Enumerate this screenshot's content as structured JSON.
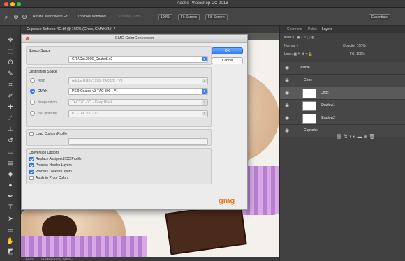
{
  "app": {
    "title": "Adobe Photoshop CC 2016"
  },
  "options": {
    "resize_windows": "Resize Windows to Fit",
    "zoom_all": "Zoom All Windows",
    "scrubby": "Scrubby Zoom",
    "zoom_pct": "100%",
    "fit_screen": "Fit Screen",
    "fill_screen": "Fill Screen",
    "workspace": "Essentials"
  },
  "document": {
    "tab": "Cupcake Schoko 4C.tif @ 100% (Choc, CMYK/8#) *",
    "status": "100%",
    "doc_info": "Unsaved GMG Ghost..."
  },
  "layers_panel": {
    "tabs": [
      "Channels",
      "Paths",
      "Layers"
    ],
    "kind": "Kind",
    "blend": "Normal",
    "opacity": "Opacity: 100%",
    "lock": "Lock:",
    "fill": "Fill: 100%",
    "layers": [
      {
        "name": "Visible",
        "type": "group"
      },
      {
        "name": "Choc",
        "type": "group"
      },
      {
        "name": "Choc",
        "type": "layer"
      },
      {
        "name": "Shadow1",
        "type": "layer"
      },
      {
        "name": "Shadow2",
        "type": "layer"
      },
      {
        "name": "Cupcake",
        "type": "group"
      }
    ]
  },
  "dialog": {
    "title": "GMG ColorConversion",
    "source_space_label": "Source Space",
    "source_profile": "GRACoL2006_Coated1v2",
    "dest_space_label": "Destination Space",
    "rgb_label": "RGB",
    "rgb_profile": "Adobe RGB (1998) TAC320 - V8",
    "cmyk_label": "CMYK",
    "cmyk_profile": "PSO Coated v3 TAC 300 - V1",
    "nsep_label": "Nseparation",
    "nsep_profile": "TAC320 - V1 - Keep Black",
    "inkopt_label": "InkOptimizer",
    "inkopt_profile": "01 - TAC300 - V3",
    "custom_label": "Load Custom Profile",
    "conv_label": "Conversion Options",
    "opt1": "Replace Assigned ICC Profile",
    "opt2": "Process Hidden Layers",
    "opt3": "Process Locked Layers",
    "opt4": "Apply to Proof Colors",
    "ok": "OK",
    "cancel": "Cancel",
    "logo": "gmg"
  },
  "colors": {
    "accent": "#3b82f6",
    "brand": "#e87722"
  }
}
